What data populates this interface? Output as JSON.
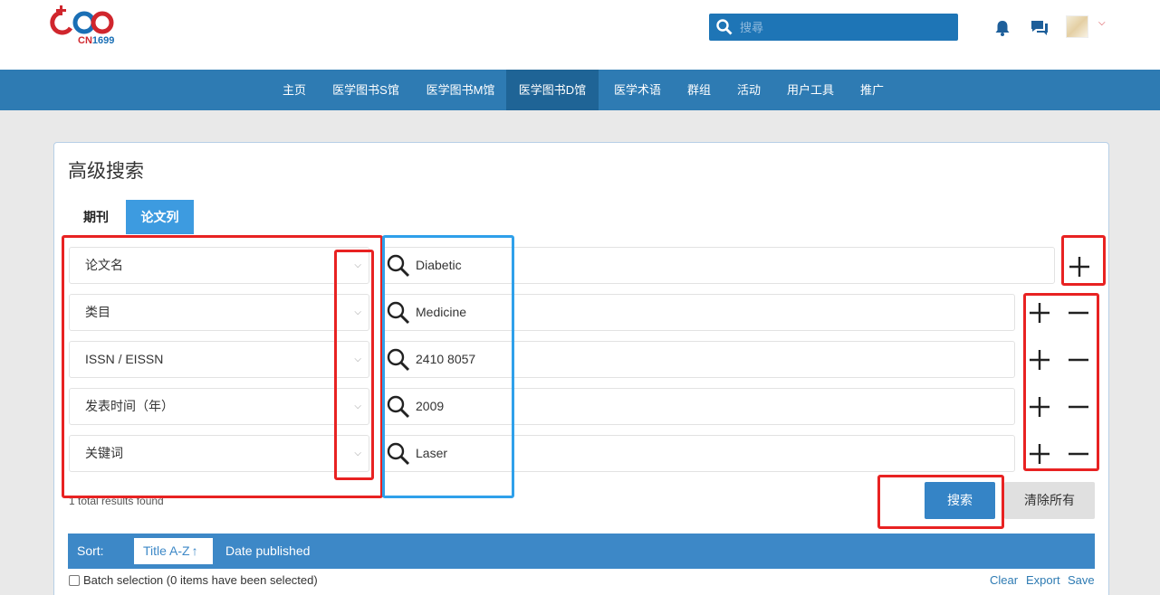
{
  "header": {
    "logo_text_cn": "CN",
    "logo_text_num": "1699",
    "search_placeholder": "搜尋"
  },
  "nav": {
    "items": [
      {
        "label": "主页"
      },
      {
        "label": "医学图书S馆"
      },
      {
        "label": "医学图书M馆"
      },
      {
        "label": "医学图书D馆",
        "active": true
      },
      {
        "label": "医学术语"
      },
      {
        "label": "群组"
      },
      {
        "label": "活动"
      },
      {
        "label": "用户工具"
      },
      {
        "label": "推广"
      }
    ]
  },
  "main": {
    "title": "高级搜索",
    "tabs": [
      {
        "label": "期刊"
      },
      {
        "label": "论文列",
        "active": true
      }
    ],
    "rows": [
      {
        "field": "论文名",
        "value": "Diabetic"
      },
      {
        "field": "类目",
        "value": "Medicine"
      },
      {
        "field": "ISSN / EISSN",
        "value": "2410 8057"
      },
      {
        "field": "发表时间（年）",
        "value": "2009"
      },
      {
        "field": "关键词",
        "value": "Laser"
      }
    ],
    "results_text": "1 total results found",
    "search_button": "搜索",
    "clear_all_button": "清除所有"
  },
  "sort": {
    "label": "Sort:",
    "title_option": "Title A-Z",
    "title_arrow": "↑",
    "date_option": "Date published"
  },
  "batch": {
    "label": "Batch selection (0 items have been selected)",
    "clear": "Clear",
    "export": "Export",
    "save": "Save"
  },
  "colors": {
    "nav_bg": "#2e7bb3",
    "nav_active": "#1f6496",
    "accent": "#3d88c7",
    "annotation_red": "#e82222",
    "annotation_blue": "#2fa0ea"
  }
}
